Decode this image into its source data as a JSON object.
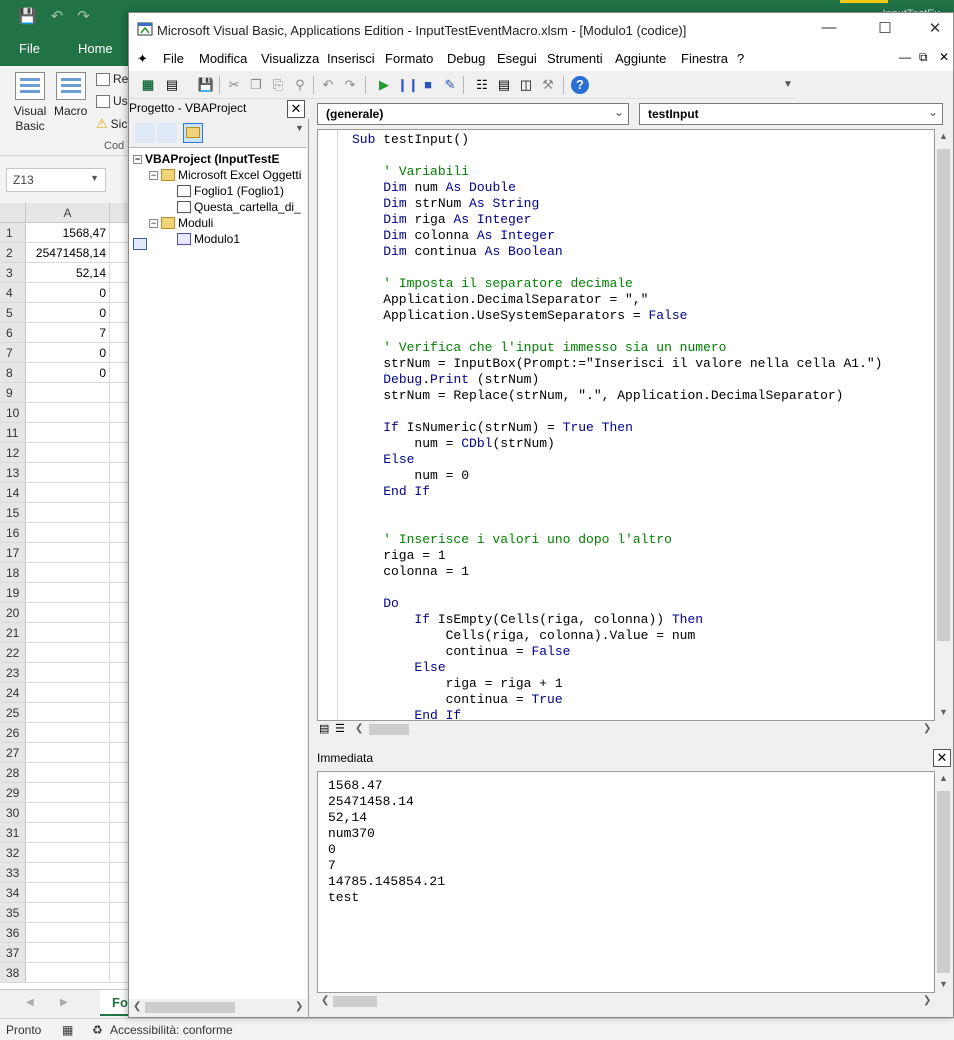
{
  "excel": {
    "tabs": [
      "File",
      "Home"
    ],
    "title_right": "InputTestEv",
    "ribbon": {
      "visual_basic": "Visual Basic",
      "macro": "Macro",
      "registra": "Re",
      "usa": "Us",
      "sicurezza": "Sic",
      "group_label": "Cod"
    },
    "namebox": "Z13",
    "col_a": "A",
    "rows": [
      {
        "n": "1",
        "a": "1568,47"
      },
      {
        "n": "2",
        "a": "25471458,14"
      },
      {
        "n": "3",
        "a": "52,14"
      },
      {
        "n": "4",
        "a": "0"
      },
      {
        "n": "5",
        "a": "0"
      },
      {
        "n": "6",
        "a": "7"
      },
      {
        "n": "7",
        "a": "0"
      },
      {
        "n": "8",
        "a": "0"
      },
      {
        "n": "9",
        "a": ""
      },
      {
        "n": "10",
        "a": ""
      },
      {
        "n": "11",
        "a": ""
      },
      {
        "n": "12",
        "a": ""
      },
      {
        "n": "13",
        "a": ""
      },
      {
        "n": "14",
        "a": ""
      },
      {
        "n": "15",
        "a": ""
      },
      {
        "n": "16",
        "a": ""
      },
      {
        "n": "17",
        "a": ""
      },
      {
        "n": "18",
        "a": ""
      },
      {
        "n": "19",
        "a": ""
      },
      {
        "n": "20",
        "a": ""
      },
      {
        "n": "21",
        "a": ""
      },
      {
        "n": "22",
        "a": ""
      },
      {
        "n": "23",
        "a": ""
      },
      {
        "n": "24",
        "a": ""
      },
      {
        "n": "25",
        "a": ""
      },
      {
        "n": "26",
        "a": ""
      },
      {
        "n": "27",
        "a": ""
      },
      {
        "n": "28",
        "a": ""
      },
      {
        "n": "29",
        "a": ""
      },
      {
        "n": "30",
        "a": ""
      },
      {
        "n": "31",
        "a": ""
      },
      {
        "n": "32",
        "a": ""
      },
      {
        "n": "33",
        "a": ""
      },
      {
        "n": "34",
        "a": ""
      },
      {
        "n": "35",
        "a": ""
      },
      {
        "n": "36",
        "a": ""
      },
      {
        "n": "37",
        "a": ""
      },
      {
        "n": "38",
        "a": ""
      }
    ],
    "sheet_tab": "Fo",
    "status_ready": "Pronto",
    "status_accessibility": "Accessibilità: conforme"
  },
  "vbe": {
    "title": "Microsoft Visual Basic, Applications Edition - InputTestEventMacro.xlsm - [Modulo1 (codice)]",
    "menu": [
      "File",
      "Modifica",
      "Visualizza",
      "Inserisci",
      "Formato",
      "Debug",
      "Esegui",
      "Strumenti",
      "Aggiunte",
      "Finestra",
      "?"
    ],
    "project": {
      "title": "Progetto - VBAProject",
      "root": "VBAProject (InputTestE",
      "excel_objects": "Microsoft Excel Oggetti",
      "sheet1": "Foglio1 (Foglio1)",
      "workbook": "Questa_cartella_di_",
      "modules": "Moduli",
      "module1": "Modulo1"
    },
    "code": {
      "object_combo": "(generale)",
      "proc_combo": "testInput",
      "lines": [
        [
          [
            "kw",
            "Sub "
          ],
          [
            "t",
            "testInput()"
          ]
        ],
        [],
        [
          [
            "t",
            "    "
          ],
          [
            "cm",
            "' Variabili"
          ]
        ],
        [
          [
            "t",
            "    "
          ],
          [
            "kw",
            "Dim "
          ],
          [
            "t",
            "num "
          ],
          [
            "kw",
            "As Double"
          ]
        ],
        [
          [
            "t",
            "    "
          ],
          [
            "kw",
            "Dim "
          ],
          [
            "t",
            "strNum "
          ],
          [
            "kw",
            "As String"
          ]
        ],
        [
          [
            "t",
            "    "
          ],
          [
            "kw",
            "Dim "
          ],
          [
            "t",
            "riga "
          ],
          [
            "kw",
            "As Integer"
          ]
        ],
        [
          [
            "t",
            "    "
          ],
          [
            "kw",
            "Dim "
          ],
          [
            "t",
            "colonna "
          ],
          [
            "kw",
            "As Integer"
          ]
        ],
        [
          [
            "t",
            "    "
          ],
          [
            "kw",
            "Dim "
          ],
          [
            "t",
            "continua "
          ],
          [
            "kw",
            "As Boolean"
          ]
        ],
        [],
        [
          [
            "t",
            "    "
          ],
          [
            "cm",
            "' Imposta il separatore decimale"
          ]
        ],
        [
          [
            "t",
            "    Application.DecimalSeparator = \",\""
          ]
        ],
        [
          [
            "t",
            "    Application.UseSystemSeparators = "
          ],
          [
            "kw",
            "False"
          ]
        ],
        [],
        [
          [
            "t",
            "    "
          ],
          [
            "cm",
            "' Verifica che l'input immesso sia un numero"
          ]
        ],
        [
          [
            "t",
            "    strNum = InputBox(Prompt:=\"Inserisci il valore nella cella A1.\")"
          ]
        ],
        [
          [
            "t",
            "    "
          ],
          [
            "kw",
            "Debug"
          ],
          [
            "t",
            "."
          ],
          [
            "kw",
            "Print"
          ],
          [
            "t",
            " (strNum)"
          ]
        ],
        [
          [
            "t",
            "    strNum = Replace(strNum, \".\", Application.DecimalSeparator)"
          ]
        ],
        [],
        [
          [
            "t",
            "    "
          ],
          [
            "kw",
            "If "
          ],
          [
            "t",
            "IsNumeric(strNum) = "
          ],
          [
            "kw",
            "True Then"
          ]
        ],
        [
          [
            "t",
            "        num = "
          ],
          [
            "kw",
            "CDbl"
          ],
          [
            "t",
            "(strNum)"
          ]
        ],
        [
          [
            "t",
            "    "
          ],
          [
            "kw",
            "Else"
          ]
        ],
        [
          [
            "t",
            "        num = 0"
          ]
        ],
        [
          [
            "t",
            "    "
          ],
          [
            "kw",
            "End If"
          ]
        ],
        [],
        [],
        [
          [
            "t",
            "    "
          ],
          [
            "cm",
            "' Inserisce i valori uno dopo l'altro"
          ]
        ],
        [
          [
            "t",
            "    riga = 1"
          ]
        ],
        [
          [
            "t",
            "    colonna = 1"
          ]
        ],
        [],
        [
          [
            "t",
            "    "
          ],
          [
            "kw",
            "Do"
          ]
        ],
        [
          [
            "t",
            "        "
          ],
          [
            "kw",
            "If "
          ],
          [
            "t",
            "IsEmpty(Cells(riga, colonna)) "
          ],
          [
            "kw",
            "Then"
          ]
        ],
        [
          [
            "t",
            "            Cells(riga, colonna).Value = num"
          ]
        ],
        [
          [
            "t",
            "            continua = "
          ],
          [
            "kw",
            "False"
          ]
        ],
        [
          [
            "t",
            "        "
          ],
          [
            "kw",
            "Else"
          ]
        ],
        [
          [
            "t",
            "            riga = riga + 1"
          ]
        ],
        [
          [
            "t",
            "            continua = "
          ],
          [
            "kw",
            "True"
          ]
        ],
        [
          [
            "t",
            "        "
          ],
          [
            "kw",
            "End If"
          ]
        ]
      ]
    },
    "immediate": {
      "title": "Immediata",
      "lines": [
        "1568.47",
        "25471458.14",
        "52,14",
        "num370",
        "0",
        "7",
        "14785.145854.21",
        "test"
      ]
    }
  }
}
